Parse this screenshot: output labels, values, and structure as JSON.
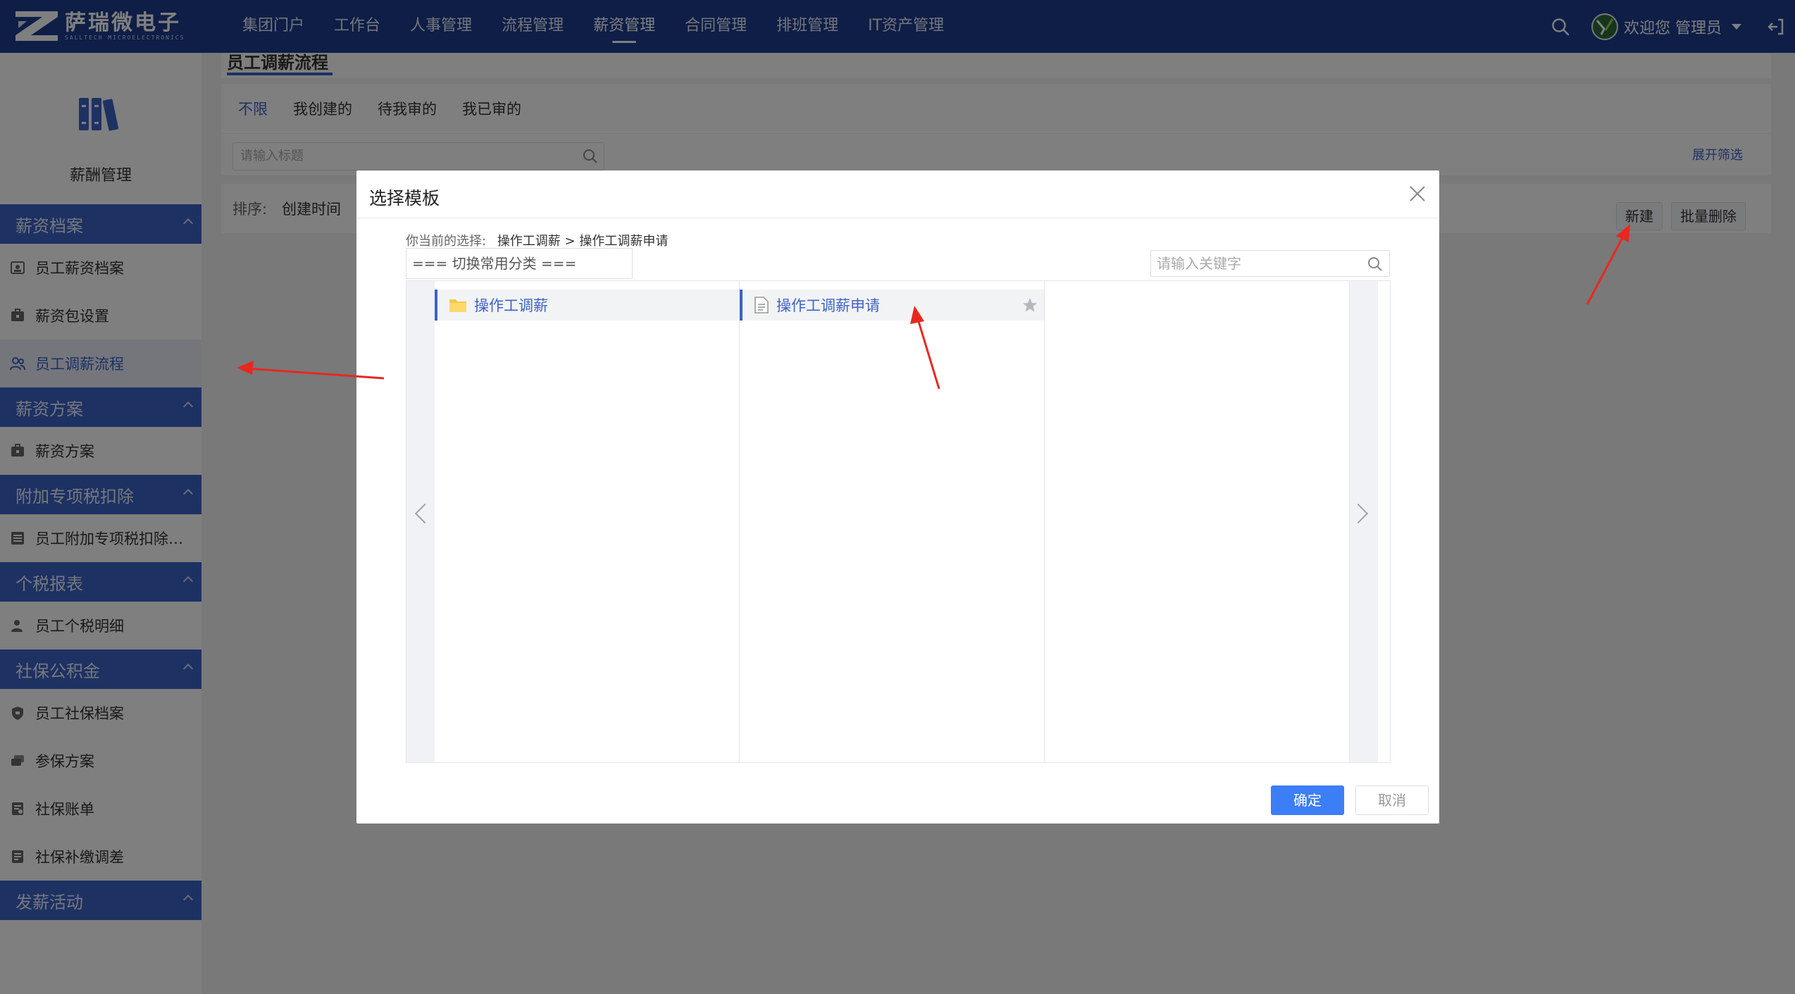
{
  "brand": {
    "name_cn": "萨瑞微电子",
    "name_en": "SALLTECH MICROELECTRONICS"
  },
  "nav": {
    "items": [
      "集团门户",
      "工作台",
      "人事管理",
      "流程管理",
      "薪资管理",
      "合同管理",
      "排班管理",
      "IT资产管理"
    ],
    "active": "薪资管理"
  },
  "user": {
    "welcome": "欢迎您 管理员"
  },
  "sidebar": {
    "module_title": "薪酬管理",
    "groups": [
      {
        "title": "薪资档案",
        "items": [
          "员工薪资档案",
          "薪资包设置",
          "员工调薪流程"
        ]
      },
      {
        "title": "薪资方案",
        "items": [
          "薪资方案"
        ]
      },
      {
        "title": "附加专项税扣除",
        "items": [
          "员工附加专项税扣除…"
        ]
      },
      {
        "title": "个税报表",
        "items": [
          "员工个税明细"
        ]
      },
      {
        "title": "社保公积金",
        "items": [
          "员工社保档案",
          "参保方案",
          "社保账单",
          "社保补缴调差"
        ]
      },
      {
        "title": "发薪活动",
        "items": []
      }
    ],
    "active_item": "员工调薪流程"
  },
  "page": {
    "title": "员工调薪流程",
    "filter_tabs": [
      "不限",
      "我创建的",
      "待我审的",
      "我已审的"
    ],
    "active_tab": "不限",
    "title_search_placeholder": "请输入标题",
    "expand_filter": "展开筛选",
    "sort_label": "排序:",
    "sort_value": "创建时间",
    "new_button": "新建",
    "batch_delete_button": "批量删除"
  },
  "modal": {
    "title": "选择模板",
    "selection_label": "你当前的选择:",
    "selection_path": "操作工调薪 > 操作工调薪申请",
    "category_select": "=== 切换常用分类 ===",
    "keyword_placeholder": "请输入关键字",
    "columns": [
      {
        "selected": "操作工调薪",
        "type": "folder"
      },
      {
        "selected": "操作工调薪申请",
        "type": "document"
      },
      {
        "selected": "",
        "type": "empty"
      }
    ],
    "confirm_button": "确定",
    "cancel_button": "取消"
  },
  "colors": {
    "topbar": "#1c3c8e",
    "sidebar_group": "#3d63c7",
    "accent": "#3d63c7",
    "primary_button": "#3c7ef5",
    "annotation_arrow": "#e8281f"
  }
}
